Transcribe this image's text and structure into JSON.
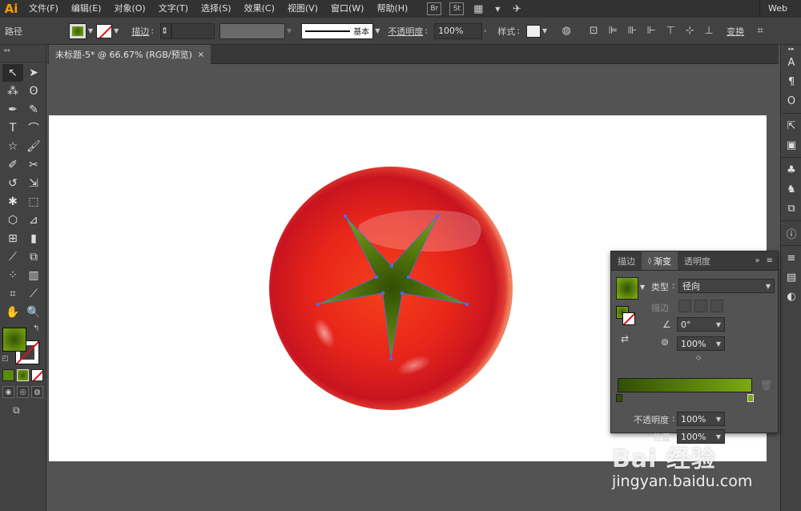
{
  "app": {
    "logo": "Ai",
    "workspace": "Web",
    "bridge": "Br",
    "stock": "St"
  },
  "menu": [
    "文件(F)",
    "编辑(E)",
    "对象(O)",
    "文字(T)",
    "选择(S)",
    "效果(C)",
    "视图(V)",
    "窗口(W)",
    "帮助(H)"
  ],
  "control": {
    "object_type": "路径",
    "stroke_label": "描边",
    "stroke_weight": "",
    "line_style": "基本",
    "opacity_label": "不透明度",
    "opacity_value": "100%",
    "style_label": "样式",
    "transform_label": "变换"
  },
  "document": {
    "tab_title": "未标题-5* @ 66.67% (RGB/预览)",
    "close": "×"
  },
  "gradient_panel": {
    "tabs": [
      "描边",
      "渐变",
      "透明度"
    ],
    "type_label": "类型",
    "type_value": "径向",
    "stroke_label": "描边",
    "angle_value": "0°",
    "aspect_value": "100%",
    "opacity_label": "不透明度",
    "opacity_value": "100%",
    "location_label": "位置",
    "location_value": "100%",
    "ramp_start_color": "#324f04",
    "ramp_end_color": "#7aaa12"
  },
  "colors": {
    "tomato_center": "#f03010",
    "tomato_edge": "#c01018",
    "leaf": "#4a6a12",
    "fill_swatch": "#5a8a0c",
    "anchor": "#4a6cf0"
  },
  "watermark": {
    "logo": "Bai  经验",
    "url": "jingyan.baidu.com"
  }
}
